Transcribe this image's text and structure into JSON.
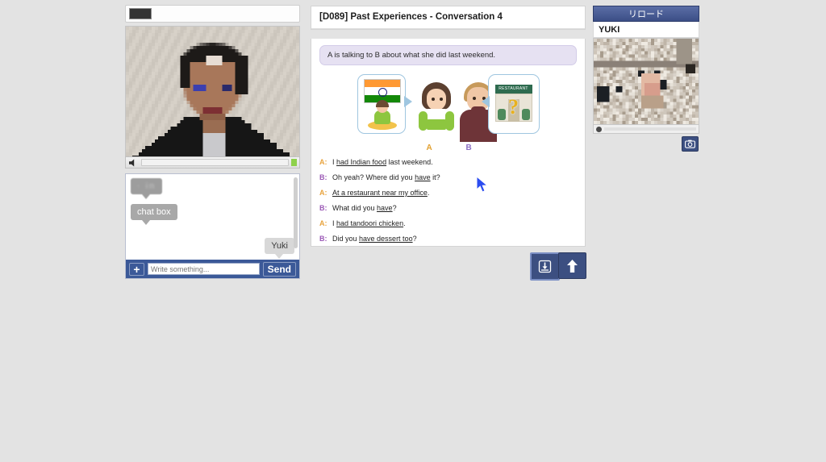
{
  "page": {
    "background_color": "#e3e3e3"
  },
  "video_panel": {
    "topbar_redaction": "redacted-block",
    "speaker_icon": "speaker-icon",
    "volume_indicator_color": "#8ed14b",
    "video_description": "pixelated-webcam-video"
  },
  "chat": {
    "messages": [
      {
        "id": "msg1",
        "text": "· in",
        "redacted": true,
        "side": "left"
      },
      {
        "id": "msg2",
        "text": "chat box",
        "redacted": false,
        "side": "left"
      },
      {
        "id": "msg3",
        "text": "Yuki",
        "redacted": false,
        "side": "right"
      }
    ],
    "add_label": "+",
    "input_placeholder": "Write something...",
    "input_value": "",
    "send_label": "Send"
  },
  "lesson": {
    "title": "[D089] Past Experiences - Conversation 4",
    "prompt": "A is talking to B about what she did last weekend.",
    "illustration": {
      "left_bubble": "indian-flag-and-woman-eating",
      "right_bubble": "restaurant-with-question-mark",
      "restaurant_sign": "RESTAURANT",
      "question_mark": "?",
      "label_a": "A",
      "label_b": "B",
      "color_a": "#e2a02f",
      "color_b": "#8b6fc4"
    },
    "dialogue": [
      {
        "speaker": "A",
        "parts": [
          {
            "text": "I ",
            "underline": false
          },
          {
            "text": "had Indian food",
            "underline": true
          },
          {
            "text": " last weekend.",
            "underline": false
          }
        ]
      },
      {
        "speaker": "B",
        "parts": [
          {
            "text": "Oh yeah? Where did you ",
            "underline": false
          },
          {
            "text": "have",
            "underline": true
          },
          {
            "text": " it?",
            "underline": false
          }
        ]
      },
      {
        "speaker": "A",
        "parts": [
          {
            "text": "At a restaurant near my office",
            "underline": true
          },
          {
            "text": ".",
            "underline": false
          }
        ]
      },
      {
        "speaker": "B",
        "parts": [
          {
            "text": "What did you ",
            "underline": false
          },
          {
            "text": "have",
            "underline": true
          },
          {
            "text": "?",
            "underline": false
          }
        ]
      },
      {
        "speaker": "A",
        "parts": [
          {
            "text": "I ",
            "underline": false
          },
          {
            "text": "had tandoori chicken",
            "underline": true
          },
          {
            "text": ".",
            "underline": false
          }
        ]
      },
      {
        "speaker": "B",
        "parts": [
          {
            "text": "Did you ",
            "underline": false
          },
          {
            "text": "have dessert too",
            "underline": true
          },
          {
            "text": "?",
            "underline": false
          }
        ]
      }
    ]
  },
  "nav_buttons": {
    "save_icon": "download-to-tray-icon",
    "up_icon": "arrow-up-icon"
  },
  "right_panel": {
    "reload_label": "リロード",
    "user_name": "YUKI",
    "video_description": "pixelated-room-video",
    "camera_icon": "camera-icon"
  },
  "cursor": {
    "icon": "mouse-pointer-arrow",
    "color": "#2b4cf0"
  }
}
